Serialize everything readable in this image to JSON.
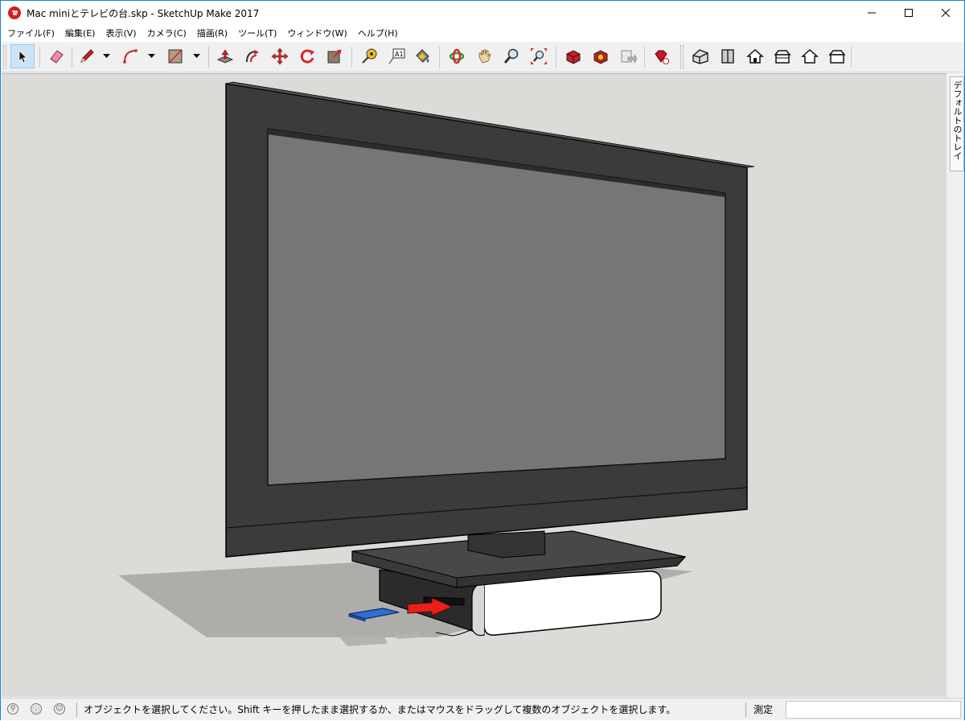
{
  "window": {
    "title": "Mac miniとテレビの台.skp - SketchUp Make 2017",
    "controls": {
      "minimize": "minimize-icon",
      "maximize": "maximize-icon",
      "close": "close-icon"
    }
  },
  "menu": {
    "items": [
      {
        "label": "ファイル(F)"
      },
      {
        "label": "編集(E)"
      },
      {
        "label": "表示(V)"
      },
      {
        "label": "カメラ(C)"
      },
      {
        "label": "描画(R)"
      },
      {
        "label": "ツール(T)"
      },
      {
        "label": "ウィンドウ(W)"
      },
      {
        "label": "ヘルプ(H)"
      }
    ]
  },
  "toolbar": {
    "tools": [
      {
        "name": "select-tool",
        "icon": "arrow-cursor-icon",
        "active": true
      },
      {
        "name": "eraser-tool",
        "icon": "eraser-icon"
      },
      {
        "name": "line-tool",
        "icon": "pencil-icon"
      },
      {
        "name": "arc-tool",
        "icon": "arc-icon"
      },
      {
        "name": "rectangle-tool",
        "icon": "rectangle-icon"
      },
      {
        "name": "push-pull-tool",
        "icon": "push-pull-icon"
      },
      {
        "name": "offset-tool",
        "icon": "offset-icon"
      },
      {
        "name": "move-tool",
        "icon": "move-icon"
      },
      {
        "name": "rotate-tool",
        "icon": "rotate-icon"
      },
      {
        "name": "scale-tool",
        "icon": "scale-icon"
      },
      {
        "name": "tape-measure-tool",
        "icon": "tape-measure-icon"
      },
      {
        "name": "text-tool",
        "icon": "text-label-icon"
      },
      {
        "name": "paint-bucket-tool",
        "icon": "paint-bucket-icon"
      },
      {
        "name": "orbit-tool",
        "icon": "orbit-icon"
      },
      {
        "name": "pan-tool",
        "icon": "hand-icon"
      },
      {
        "name": "zoom-tool",
        "icon": "magnifier-icon"
      },
      {
        "name": "zoom-extents-tool",
        "icon": "zoom-extents-icon"
      },
      {
        "name": "warehouse-tool",
        "icon": "3d-warehouse-icon"
      },
      {
        "name": "extension-warehouse-tool",
        "icon": "extension-warehouse-icon"
      },
      {
        "name": "share-model-tool",
        "icon": "share-model-icon"
      },
      {
        "name": "ruby-console-tool",
        "icon": "ruby-icon"
      },
      {
        "name": "view-iso",
        "icon": "iso-house-icon"
      },
      {
        "name": "view-top",
        "icon": "top-view-icon"
      },
      {
        "name": "view-front",
        "icon": "front-view-icon"
      },
      {
        "name": "view-right",
        "icon": "right-view-icon"
      },
      {
        "name": "view-back",
        "icon": "back-view-icon"
      },
      {
        "name": "view-left",
        "icon": "left-view-icon"
      }
    ]
  },
  "tray": {
    "label": "デフォルトのトレイ"
  },
  "status": {
    "message": "オブジェクトを選択してください。Shift キーを押したまま選択するか、またはマウスをドラッグして複数のオブジェクトを選択します。",
    "measure_label": "測定",
    "measure_value": ""
  },
  "colors": {
    "accent": "#1883d7",
    "background_canvas": "#dcdbd7",
    "tv_body": "#3c3c3c",
    "tv_screen": "#767676",
    "sd_card": "#2f6fd1",
    "arrow": "#e8201c"
  }
}
